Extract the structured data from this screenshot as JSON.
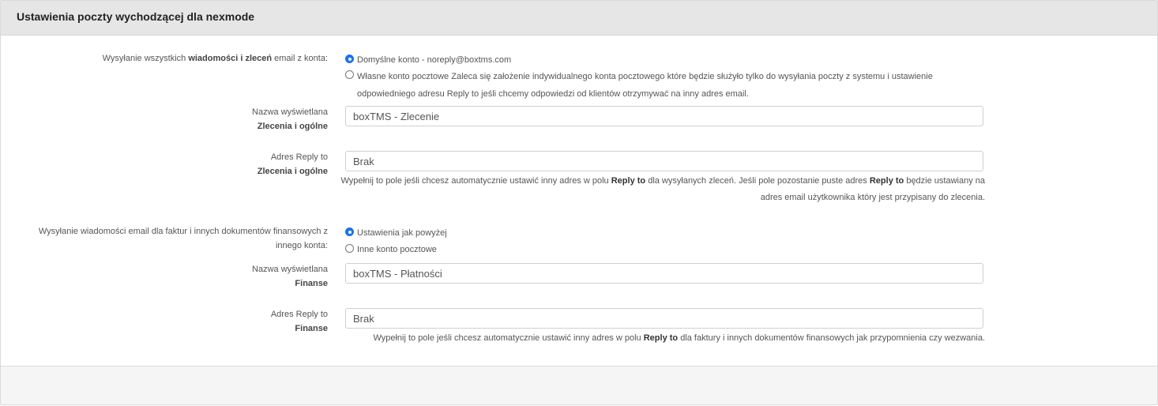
{
  "panel": {
    "title": "Ustawienia poczty wychodzącej dla nexmode"
  },
  "section1": {
    "label_pre": "Wysyłanie wszystkich ",
    "label_bold": "wiadomości i zleceń",
    "label_post": " email z konta:",
    "options": [
      {
        "label": "Domyślne konto - noreply@boxtms.com",
        "checked": true
      },
      {
        "label_line1": "Własne konto pocztowe Zaleca się założenie indywidualnego konta pocztowego które będzie służyło tylko do wysyłania poczty z systemu i ustawienie",
        "label_line2": "odpowiedniego adresu Reply to jeśli chcemy odpowiedzi od klientów otrzymywać na inny adres email.",
        "checked": false
      }
    ],
    "name_label": "Nazwa wyświetlana",
    "name_sublabel": "Zlecenia i ogólne",
    "name_value": "boxTMS - Zlecenie",
    "reply_label": "Adres Reply to",
    "reply_sublabel": "Zlecenia i ogólne",
    "reply_value": "Brak",
    "help_a": "Wypełnij to pole jeśli chcesz automatycznie ustawić inny adres w polu ",
    "help_b": "Reply to",
    "help_c": " dla wysyłanych zleceń. Jeśli pole pozostanie puste adres ",
    "help_d": "Reply to",
    "help_e": " będzie ustawiany na",
    "help_line2": "adres email użytkownika który jest przypisany do zlecenia."
  },
  "section2": {
    "label_line1": "Wysyłanie wiadomości email dla faktur i innych dokumentów finansowych z",
    "label_line2": "innego konta:",
    "options": [
      {
        "label": "Ustawienia jak powyżej",
        "checked": true
      },
      {
        "label": "Inne konto pocztowe",
        "checked": false
      }
    ],
    "name_label": "Nazwa wyświetlana",
    "name_sublabel": "Finanse",
    "name_value": "boxTMS - Płatności",
    "reply_label": "Adres Reply to",
    "reply_sublabel": "Finanse",
    "reply_value": "Brak",
    "help_a": "Wypełnij to pole jeśli chcesz automatycznie ustawić inny adres w polu ",
    "help_b": "Reply to",
    "help_c": " dla faktury i innych dokumentów finansowych jak przypomnienia czy wezwania."
  }
}
